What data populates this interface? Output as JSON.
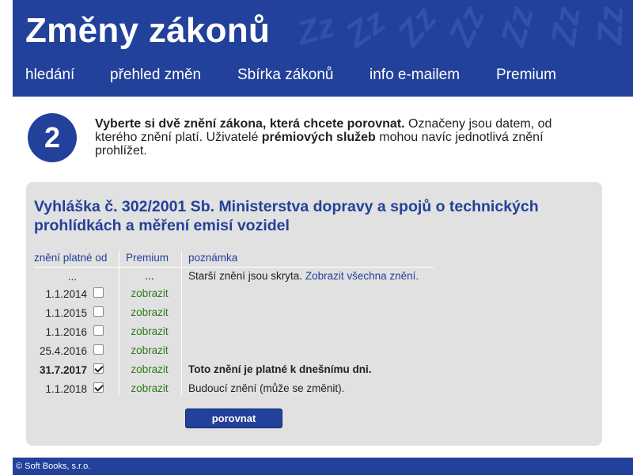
{
  "header": {
    "site_title": "Změny zákonů",
    "decor_text": "Zz Zz Zz Zz Zz Zz Zz",
    "nav": [
      {
        "label": "hledání"
      },
      {
        "label": "přehled změn"
      },
      {
        "label": "Sbírka zákonů"
      },
      {
        "label": "info e-mailem"
      },
      {
        "label": "Premium"
      }
    ]
  },
  "step": {
    "number": "2",
    "intro_bold1": "Vyberte si dvě znění zákona, která chcete porovnat.",
    "intro_text1": " Označeny jsou datem, od kterého znění platí. Uživatelé ",
    "intro_bold2": "prémiových služeb",
    "intro_text2": " mohou navíc jednotlivá znění prohlížet."
  },
  "document": {
    "title": "Vyhláška č. 302/2001 Sb. Ministerstva dopravy a spojů o technických prohlídkách a měření emisí vozidel"
  },
  "table": {
    "headers": {
      "valid_from": "znění platné od",
      "premium": "Premium",
      "note": "poznámka"
    },
    "dots_row": {
      "date": "...",
      "premium": "...",
      "note_text": "Starší znění jsou skryta.",
      "note_link": "Zobrazit všechna znění."
    },
    "rows": [
      {
        "date": "1.1.2014",
        "checked": false,
        "premium": "zobrazit",
        "note": ""
      },
      {
        "date": "1.1.2015",
        "checked": false,
        "premium": "zobrazit",
        "note": ""
      },
      {
        "date": "1.1.2016",
        "checked": false,
        "premium": "zobrazit",
        "note": ""
      },
      {
        "date": "25.4.2016",
        "checked": false,
        "premium": "zobrazit",
        "note": ""
      },
      {
        "date": "31.7.2017",
        "checked": true,
        "premium": "zobrazit",
        "note": "Toto znění je platné k dnešnímu dni.",
        "bold": true
      },
      {
        "date": "1.1.2018",
        "checked": true,
        "premium": "zobrazit",
        "note": "Budoucí znění (může se změnit)."
      }
    ]
  },
  "compare_button": "porovnat",
  "footer": {
    "text": "© Soft Books, s.r.o."
  },
  "colors": {
    "brand_blue": "#22419a",
    "panel_bg": "#e1e1e1",
    "link_green": "#2c7a18"
  }
}
